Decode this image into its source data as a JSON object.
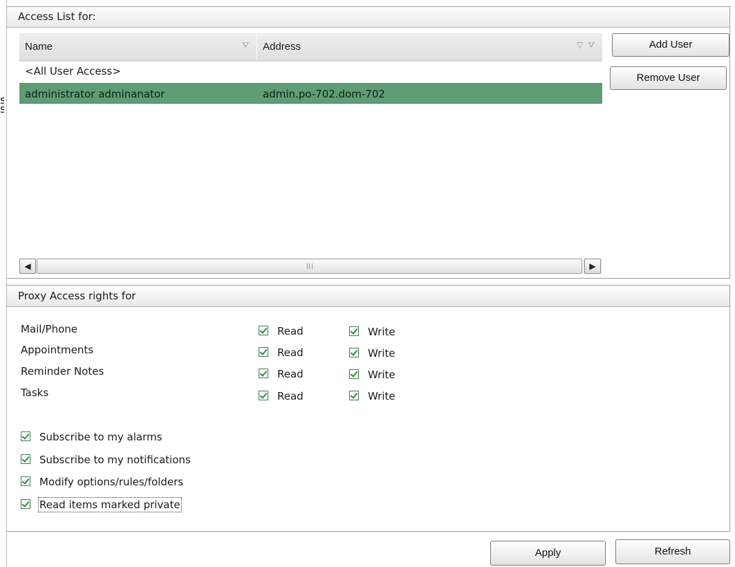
{
  "access_panel": {
    "title": "Access List for:",
    "columns": {
      "name": "Name",
      "address": "Address"
    },
    "rows": [
      {
        "name": "<All User Access>",
        "address": ""
      },
      {
        "name": "administrator  adminanator",
        "address": "admin.po-702.dom-702",
        "selected": true
      }
    ],
    "buttons": {
      "add_user": "Add User",
      "remove_user": "Remove User"
    },
    "selection_color": "#5f9d74"
  },
  "rights_panel": {
    "title": "Proxy Access rights for",
    "items": [
      {
        "label": "Mail/Phone",
        "read": "Read",
        "write": "Write",
        "read_checked": true,
        "write_checked": true
      },
      {
        "label": "Appointments",
        "read": "Read",
        "write": "Write",
        "read_checked": true,
        "write_checked": true
      },
      {
        "label": "Reminder Notes",
        "read": "Read",
        "write": "Write",
        "read_checked": true,
        "write_checked": true
      },
      {
        "label": "Tasks",
        "read": "Read",
        "write": "Write",
        "read_checked": true,
        "write_checked": true
      }
    ],
    "options": [
      {
        "label": "Subscribe to my alarms",
        "checked": true
      },
      {
        "label": "Subscribe to my notifications",
        "checked": true
      },
      {
        "label": "Modify options/rules/folders",
        "checked": true
      },
      {
        "label": "Read items marked private",
        "checked": true
      }
    ]
  },
  "footer": {
    "apply": "Apply",
    "refresh": "Refresh"
  },
  "icons": {
    "filter": "filter-icon",
    "sort": "sort-icon",
    "scroll_left": "scroll-left-arrow-icon",
    "scroll_right": "scroll-right-arrow-icon",
    "checkmark": "checkmark-icon"
  },
  "colors": {
    "accent_green": "#2e8a48",
    "header_gradient_top": "#fdfdfd",
    "header_gradient_bottom": "#e9e9e9"
  }
}
